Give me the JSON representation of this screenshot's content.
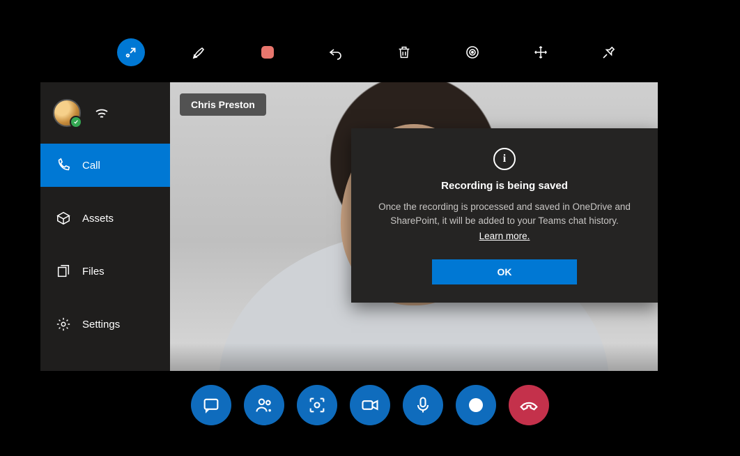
{
  "participant": {
    "name": "Chris Preston"
  },
  "sidebar": {
    "items": [
      {
        "icon": "phone-icon",
        "label": "Call",
        "active": true
      },
      {
        "icon": "assets-icon",
        "label": "Assets",
        "active": false
      },
      {
        "icon": "files-icon",
        "label": "Files",
        "active": false
      },
      {
        "icon": "settings-icon",
        "label": "Settings",
        "active": false
      }
    ]
  },
  "dialog": {
    "title": "Recording is being saved",
    "body": "Once the recording is processed and saved in OneDrive and SharePoint, it will be added to your Teams chat history.",
    "learn_more": "Learn more.",
    "ok_label": "OK"
  },
  "top_toolbar": {
    "items": [
      {
        "name": "collapse-icon",
        "active": true
      },
      {
        "name": "pen-icon"
      },
      {
        "name": "stop-record-icon"
      },
      {
        "name": "undo-icon"
      },
      {
        "name": "delete-icon"
      },
      {
        "name": "camera-settings-icon"
      },
      {
        "name": "move-icon"
      },
      {
        "name": "pin-icon"
      }
    ]
  },
  "bottom_bar": {
    "items": [
      {
        "name": "chat-icon"
      },
      {
        "name": "people-icon"
      },
      {
        "name": "capture-icon"
      },
      {
        "name": "video-icon"
      },
      {
        "name": "mic-icon"
      },
      {
        "name": "record-icon"
      },
      {
        "name": "hangup-icon",
        "style": "red"
      }
    ]
  },
  "colors": {
    "accent": "#0078d4",
    "danger": "#c4314b"
  }
}
